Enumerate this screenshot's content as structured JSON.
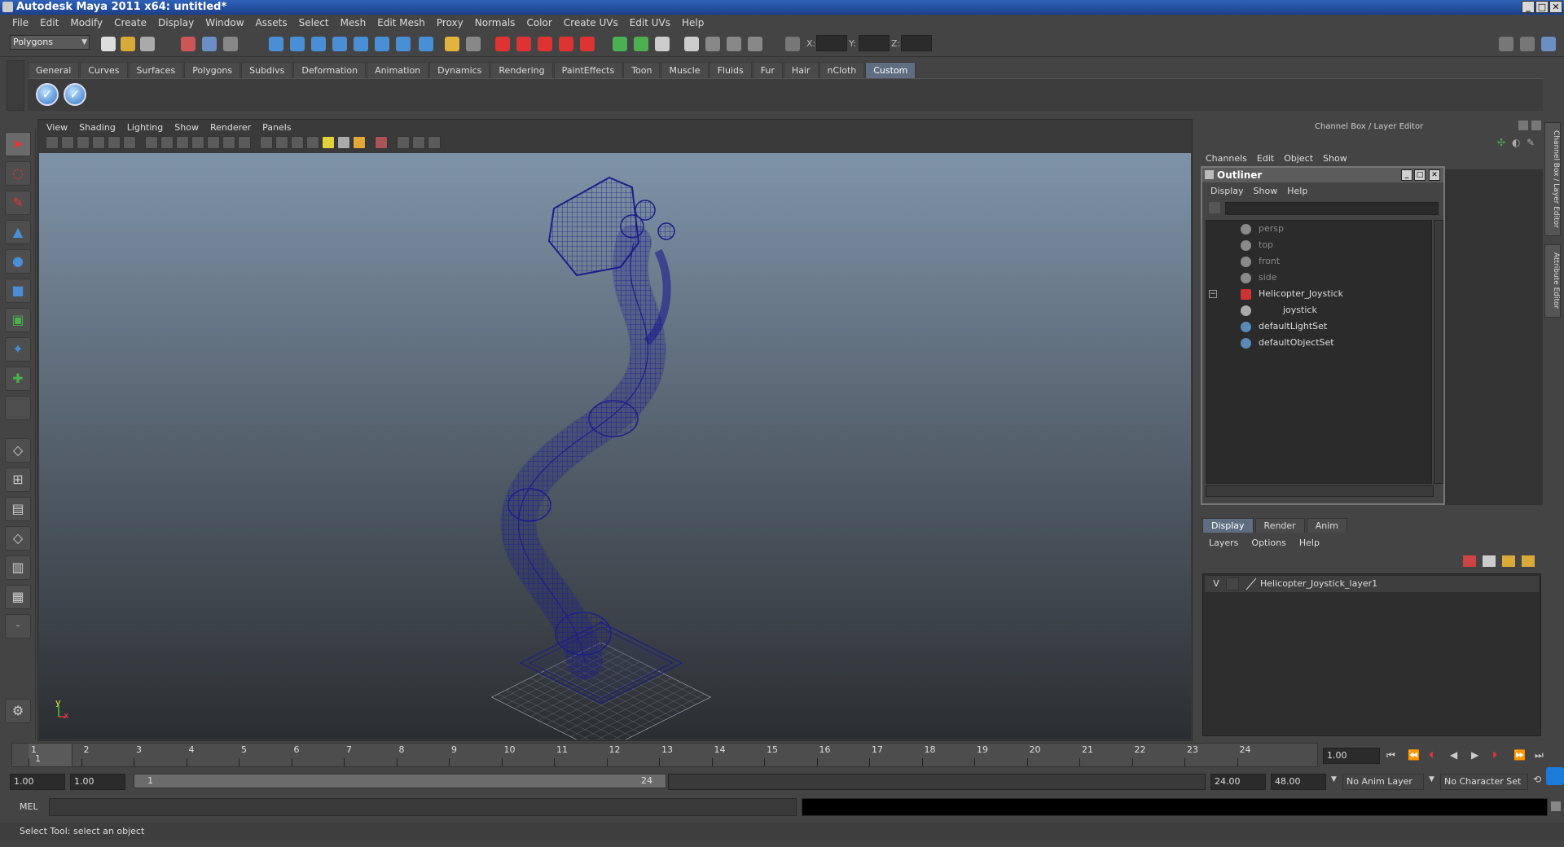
{
  "window": {
    "title": "Autodesk Maya 2011 x64: untitled*",
    "controls": [
      "_",
      "□",
      "✕"
    ]
  },
  "menubar": [
    "File",
    "Edit",
    "Modify",
    "Create",
    "Display",
    "Window",
    "Assets",
    "Select",
    "Mesh",
    "Edit Mesh",
    "Proxy",
    "Normals",
    "Color",
    "Create UVs",
    "Edit UVs",
    "Help"
  ],
  "toolbar": {
    "mode": "Polygons",
    "coord_x": "X:",
    "coord_y": "Y:",
    "coord_z": "Z:"
  },
  "shelf": {
    "tabs": [
      "General",
      "Curves",
      "Surfaces",
      "Polygons",
      "Subdivs",
      "Deformation",
      "Animation",
      "Dynamics",
      "Rendering",
      "PaintEffects",
      "Toon",
      "Muscle",
      "Fluids",
      "Fur",
      "Hair",
      "nCloth",
      "Custom"
    ],
    "active_tab": "Custom",
    "buttons": [
      "check-icon",
      "check-icon"
    ]
  },
  "viewport": {
    "menu": [
      "View",
      "Shading",
      "Lighting",
      "Show",
      "Renderer",
      "Panels"
    ],
    "axis_x": "x",
    "axis_y": "y"
  },
  "channel_box": {
    "header": "Channel Box / Layer Editor",
    "menu": [
      "Channels",
      "Edit",
      "Object",
      "Show"
    ]
  },
  "side_tabs": [
    "Channel Box / Layer Editor",
    "Attribute Editor"
  ],
  "outliner": {
    "title": "Outliner",
    "menu": [
      "Display",
      "Show",
      "Help"
    ],
    "items": [
      {
        "label": "persp",
        "dim": true
      },
      {
        "label": "top",
        "dim": true
      },
      {
        "label": "front",
        "dim": true
      },
      {
        "label": "side",
        "dim": true
      },
      {
        "label": "Helicopter_Joystick",
        "dim": false
      },
      {
        "label": "joystick",
        "dim": false
      },
      {
        "label": "defaultLightSet",
        "dim": false
      },
      {
        "label": "defaultObjectSet",
        "dim": false
      }
    ]
  },
  "layer_editor": {
    "tabs": [
      "Display",
      "Render",
      "Anim"
    ],
    "active_tab": "Display",
    "menu": [
      "Layers",
      "Options",
      "Help"
    ],
    "layers": [
      {
        "visible": "V",
        "name": "Helicopter_Joystick_layer1"
      }
    ]
  },
  "timeline": {
    "frames": [
      "1",
      "2",
      "3",
      "4",
      "5",
      "6",
      "7",
      "8",
      "9",
      "10",
      "11",
      "12",
      "13",
      "14",
      "15",
      "16",
      "17",
      "18",
      "19",
      "20",
      "21",
      "22",
      "23",
      "24"
    ],
    "current_frame": "1",
    "current_time": "1.00"
  },
  "range": {
    "start": "1.00",
    "playback_start": "1.00",
    "slider_start": "1",
    "slider_end": "24",
    "playback_end": "24.00",
    "end": "48.00",
    "anim_layer": "No Anim Layer",
    "character_set": "No Character Set"
  },
  "command_line": {
    "label": "MEL"
  },
  "status": "Select Tool: select an object",
  "colors": {
    "wireframe": "#1d1d8a",
    "accent_tab": "#5e6e80",
    "title_bar": "#2f62b8"
  }
}
